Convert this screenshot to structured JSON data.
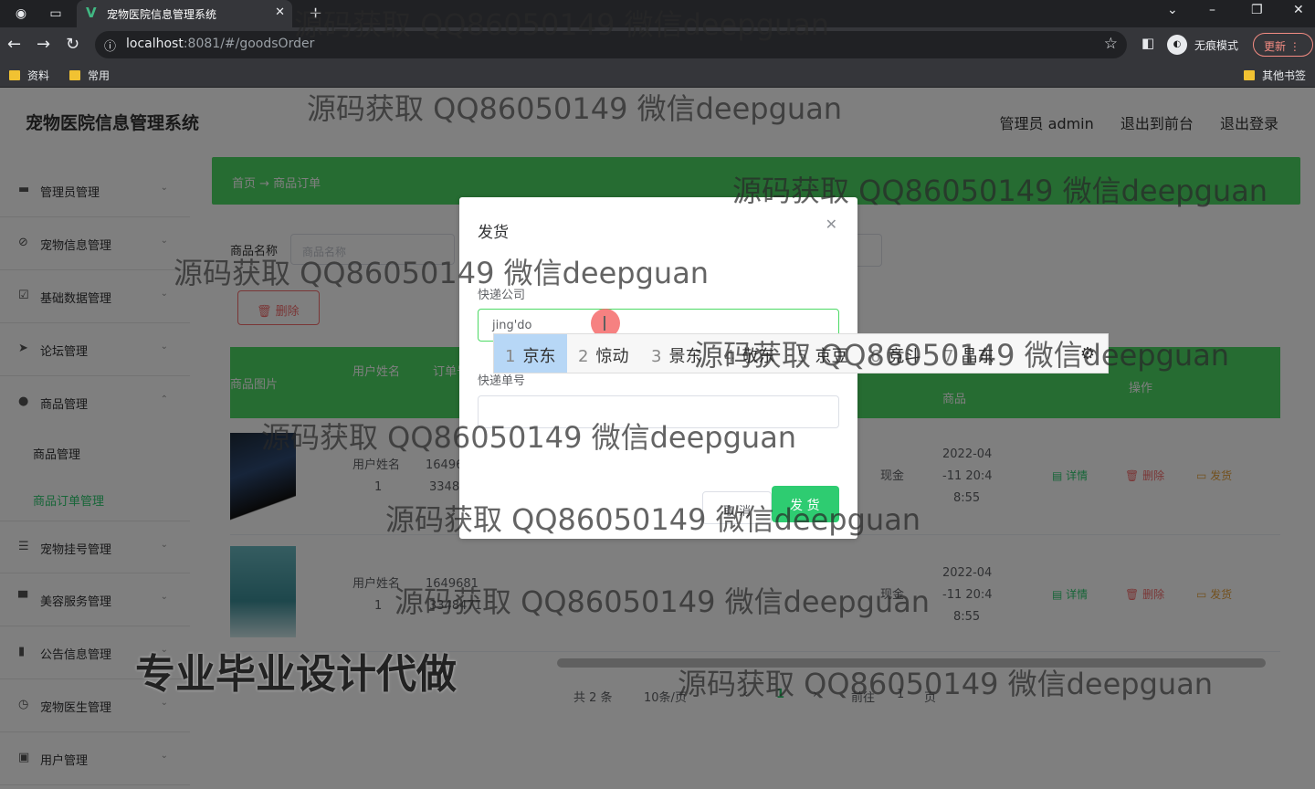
{
  "browser": {
    "tab_title": "宠物医院信息管理系统",
    "url_host": "localhost",
    "url_path": ":8081/#/goodsOrder",
    "incognito_label": "无痕模式",
    "update_label": "更新",
    "bookmarks": [
      "资料",
      "常用"
    ],
    "other_bookmarks": "其他书签"
  },
  "header": {
    "title": "宠物医院信息管理系统",
    "user": "管理员 admin",
    "back_to_front": "退出到前台",
    "logout": "退出登录"
  },
  "sidebar": {
    "items": [
      {
        "label": "管理员管理",
        "icon": "id-card-icon"
      },
      {
        "label": "宠物信息管理",
        "icon": "ban-icon"
      },
      {
        "label": "基础数据管理",
        "icon": "checkbox-icon"
      },
      {
        "label": "论坛管理",
        "icon": "send-icon"
      },
      {
        "label": "商品管理",
        "icon": "user-icon"
      }
    ],
    "sub_items": [
      "商品管理",
      "商品订单管理"
    ],
    "more_items": [
      {
        "label": "宠物挂号管理",
        "icon": "list-icon"
      },
      {
        "label": "美容服务管理",
        "icon": "board-icon"
      },
      {
        "label": "公告信息管理",
        "icon": "bar-chart-icon"
      },
      {
        "label": "宠物医生管理",
        "icon": "clock-icon"
      },
      {
        "label": "用户管理",
        "icon": "badge-icon"
      }
    ]
  },
  "breadcrumb": "首页 → 商品订单",
  "filter": {
    "label": "商品名称",
    "placeholder": "商品名称"
  },
  "delete_label": "删除",
  "table": {
    "headers": [
      "商品图片",
      "用户姓名",
      "订单号",
      "商品",
      "操作"
    ],
    "rows": [
      {
        "user_label": "用户姓名",
        "user_id": "1",
        "order_a": "16496",
        "order_b": "3348",
        "pay": "现金",
        "date_a": "2022-04",
        "date_b": "-11 20:4",
        "date_c": "8:55"
      },
      {
        "user_label": "用户姓名",
        "user_id": "1",
        "order_a": "1649681",
        "order_b": "3348471",
        "pay": "现金",
        "date_a": "2022-04",
        "date_b": "-11 20:4",
        "date_c": "8:55"
      }
    ],
    "actions": [
      "详情",
      "删除",
      "发货"
    ]
  },
  "pager": {
    "total": "共 2 条",
    "size": "10条/页",
    "current": "1",
    "goto": "前往",
    "page": "1",
    "unit": "页"
  },
  "dialog": {
    "title": "发货",
    "company_label": "快递公司",
    "company_value": "jing'do",
    "number_label": "快递单号",
    "number_value": "",
    "cancel": "取 消",
    "confirm": "发 货"
  },
  "ime": {
    "candidates": [
      {
        "n": "1",
        "w": "京东"
      },
      {
        "n": "2",
        "w": "惊动"
      },
      {
        "n": "3",
        "w": "景东"
      },
      {
        "n": "4",
        "w": "敬东"
      },
      {
        "n": "5",
        "w": "京豆"
      },
      {
        "n": "6",
        "w": "竞斗"
      },
      {
        "n": "7",
        "w": "晶东"
      }
    ]
  },
  "watermark": "源码获取 QQ86050149 微信deepguan",
  "watermark_big": "专业毕业设计代做"
}
